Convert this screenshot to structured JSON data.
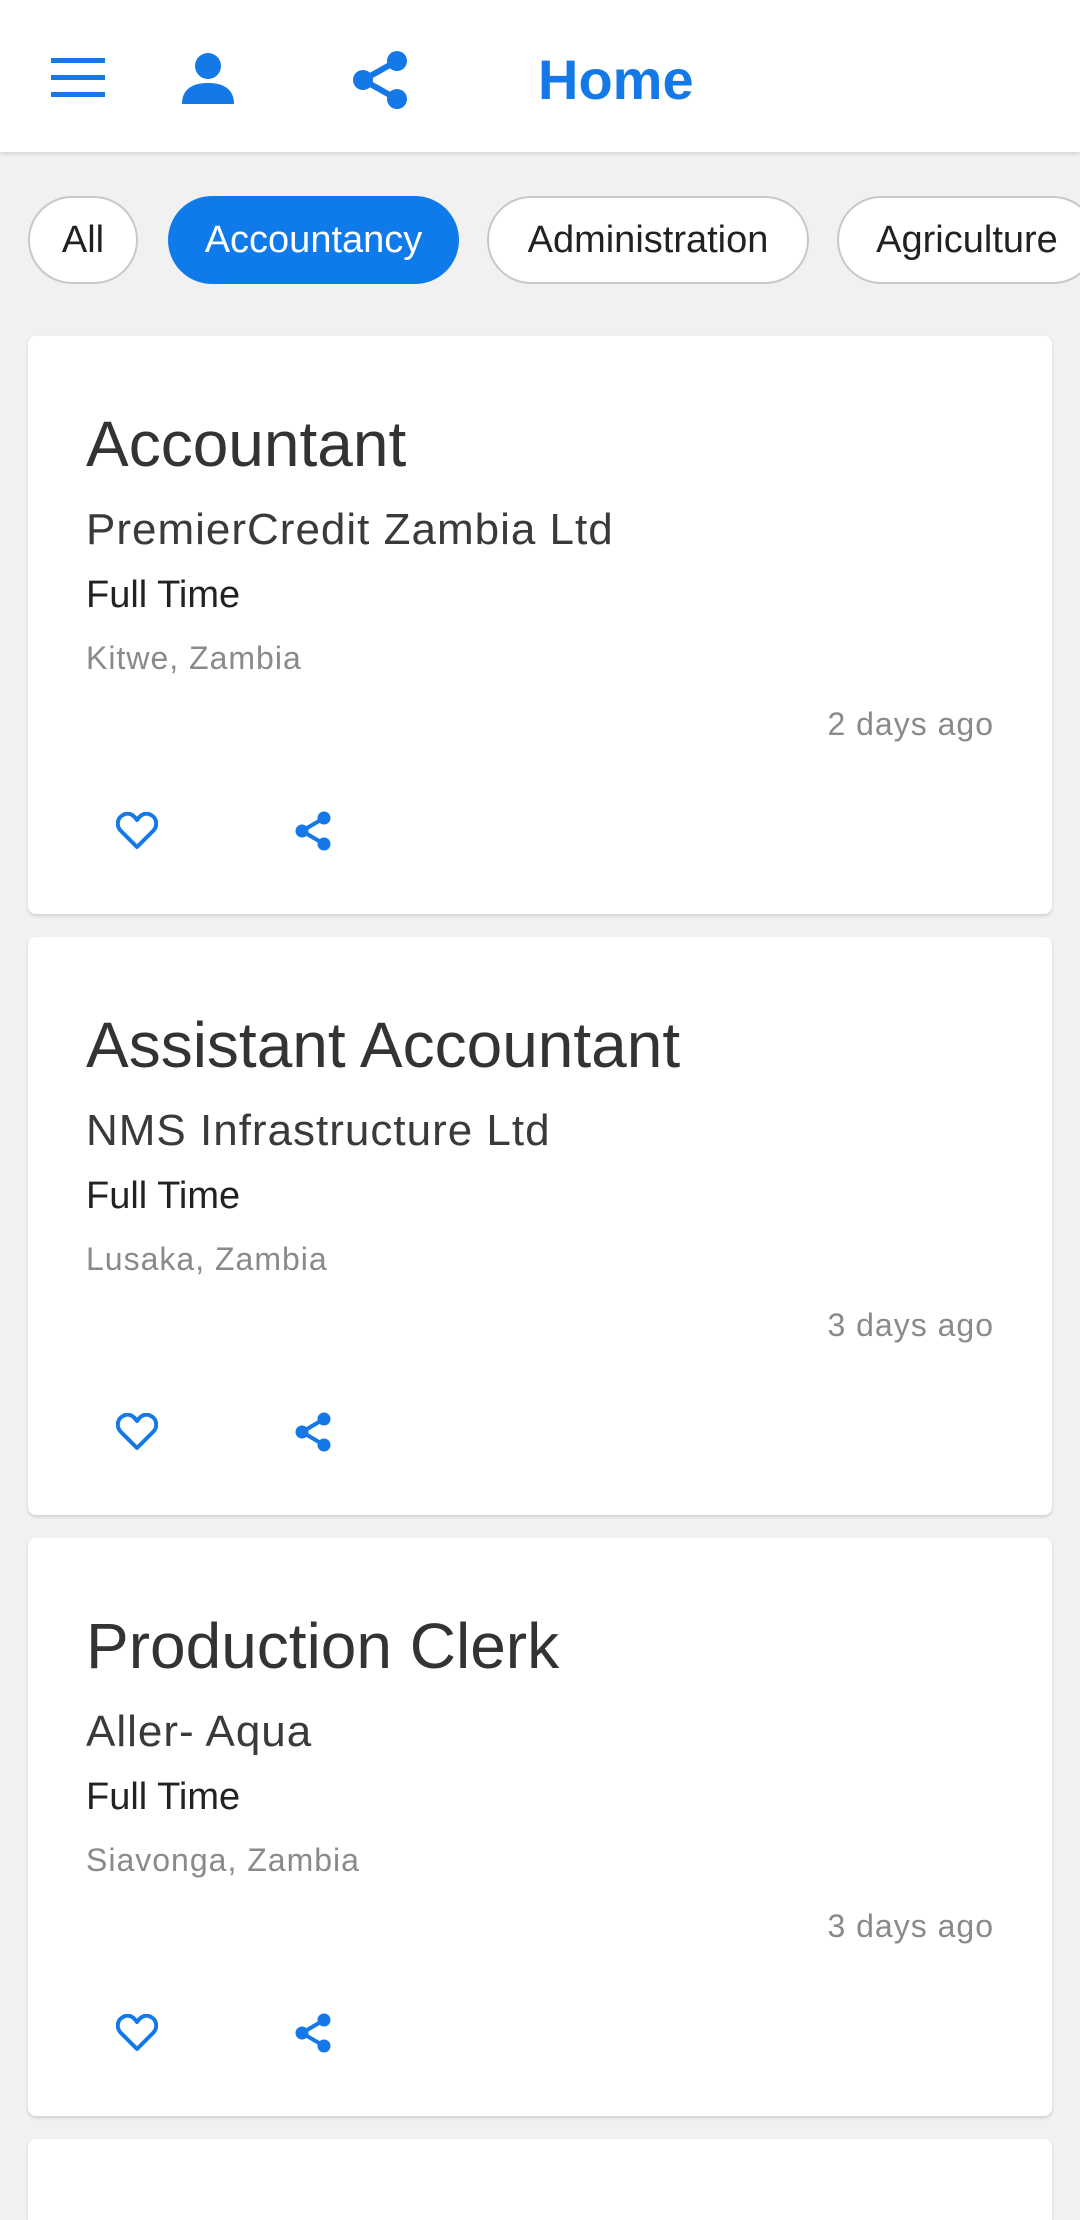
{
  "header": {
    "title": "Home",
    "menu_icon": "menu-icon",
    "profile_icon": "person-icon",
    "share_icon": "share-icon"
  },
  "colors": {
    "accent": "#1479e6",
    "chip_selected": "#0f7aea",
    "background": "#f1f1f1"
  },
  "categories": [
    {
      "label": "All",
      "selected": false
    },
    {
      "label": "Accountancy",
      "selected": true
    },
    {
      "label": "Administration",
      "selected": false
    },
    {
      "label": "Agriculture",
      "selected": false
    }
  ],
  "jobs": [
    {
      "title": "Accountant",
      "company": "PremierCredit Zambia Ltd",
      "type": "Full Time",
      "location": "Kitwe, Zambia",
      "posted": "2 days ago"
    },
    {
      "title": "Assistant Accountant",
      "company": "NMS Infrastructure Ltd",
      "type": "Full Time",
      "location": "Lusaka, Zambia",
      "posted": "3 days ago"
    },
    {
      "title": "Production Clerk",
      "company": "Aller- Aqua",
      "type": "Full Time",
      "location": "Siavonga, Zambia",
      "posted": "3 days ago"
    }
  ]
}
